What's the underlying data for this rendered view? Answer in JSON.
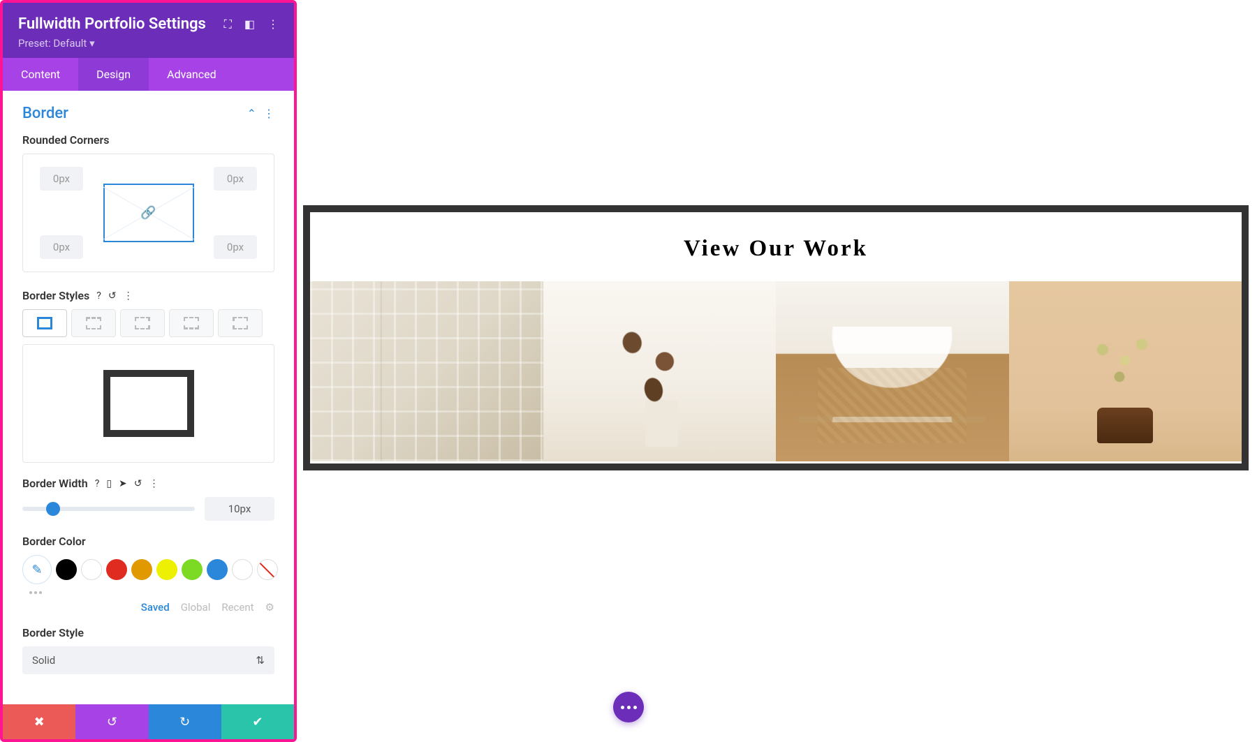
{
  "header": {
    "title": "Fullwidth Portfolio Settings",
    "preset_label": "Preset: Default"
  },
  "tabs": {
    "content": "Content",
    "design": "Design",
    "advanced": "Advanced"
  },
  "section": {
    "title": "Border"
  },
  "rounded": {
    "label": "Rounded Corners",
    "tl": "0px",
    "tr": "0px",
    "bl": "0px",
    "br": "0px"
  },
  "border_styles": {
    "label": "Border Styles"
  },
  "border_width": {
    "label": "Border Width",
    "value": "10px"
  },
  "border_color": {
    "label": "Border Color",
    "tabs": {
      "saved": "Saved",
      "global": "Global",
      "recent": "Recent"
    }
  },
  "border_style": {
    "label": "Border Style",
    "value": "Solid"
  },
  "preview": {
    "title": "View Our Work"
  }
}
